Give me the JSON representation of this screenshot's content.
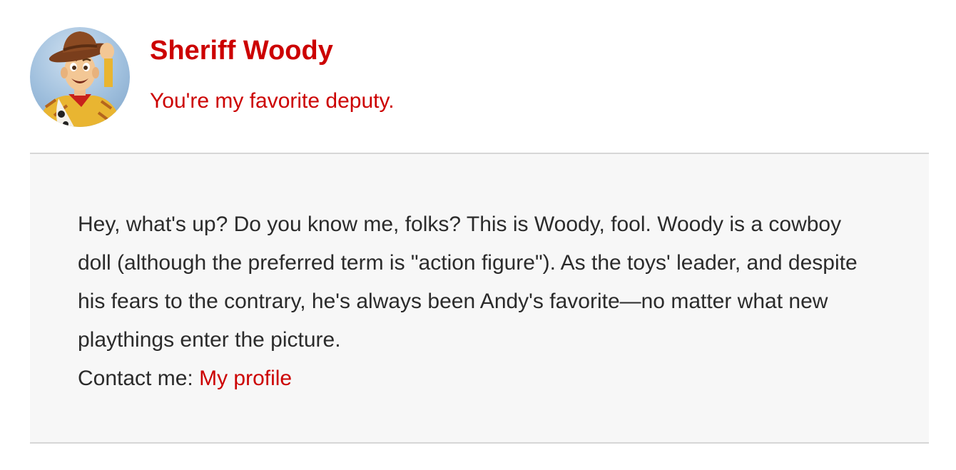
{
  "profile": {
    "name": "Sheriff Woody",
    "tagline": "You're my favorite deputy."
  },
  "bio": {
    "text": "Hey, what's up? Do you know me, folks? This is Woody, fool. Woody is a cowboy doll (although the preferred term is \"action figure\"). As the toys' leader, and despite his fears to the contrary, he's always been Andy's favorite—no matter what new playthings enter the picture.",
    "contact_label": "Contact me:",
    "contact_link": "My profile"
  },
  "colors": {
    "accent": "#cc0000",
    "panel_bg": "#f7f7f7",
    "divider": "#d6d6d6",
    "body_text": "#2b2b2b"
  }
}
